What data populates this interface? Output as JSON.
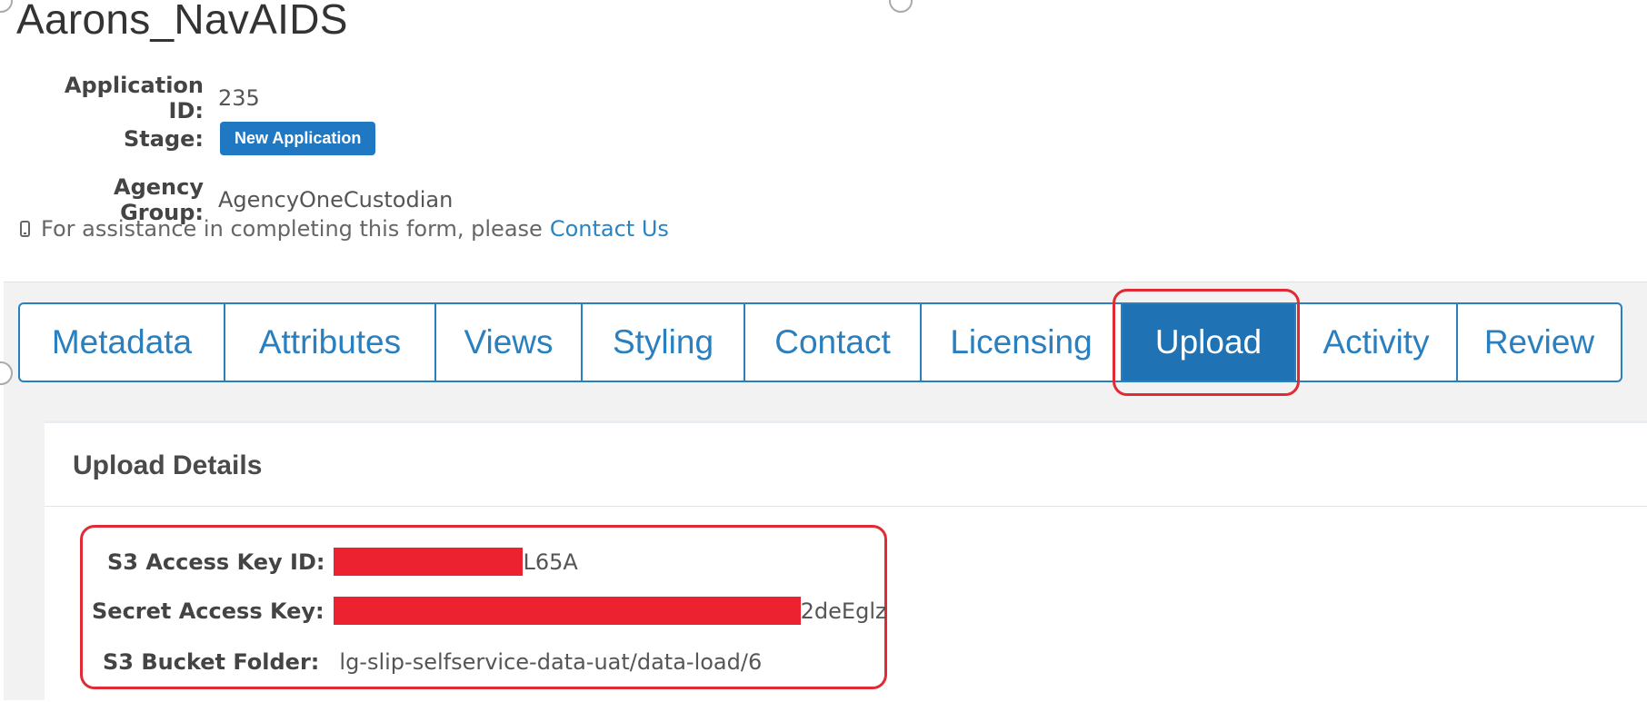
{
  "app": {
    "title": "Aarons_NavAIDS"
  },
  "info": {
    "application_id_label": "Application ID:",
    "application_id_value": "235",
    "stage_label": "Stage:",
    "stage_value": "New Application",
    "agency_group_label": "Agency Group:",
    "agency_group_value": "AgencyOneCustodian"
  },
  "assist": {
    "icon": "mobile-phone-icon",
    "text": "For assistance in completing this form, please",
    "link": "Contact Us"
  },
  "tabs": [
    {
      "label": "Metadata"
    },
    {
      "label": "Attributes"
    },
    {
      "label": "Views"
    },
    {
      "label": "Styling"
    },
    {
      "label": "Contact"
    },
    {
      "label": "Licensing"
    },
    {
      "label": "Upload",
      "active": true
    },
    {
      "label": "Activity"
    },
    {
      "label": "Review"
    }
  ],
  "upload": {
    "title": "Upload Details",
    "access_key_label": "S3 Access Key ID:",
    "access_key_visible": "L65A",
    "secret_key_label": "Secret Access Key:",
    "secret_key_visible": "2deEglz",
    "bucket_label": "S3 Bucket Folder:",
    "bucket_value": "lg-slip-selfservice-data-uat/data-load/6"
  },
  "colors": {
    "accent": "#1f72b3",
    "link": "#2a84c4",
    "highlight": "#e02a34",
    "redaction": "#ec2230"
  }
}
